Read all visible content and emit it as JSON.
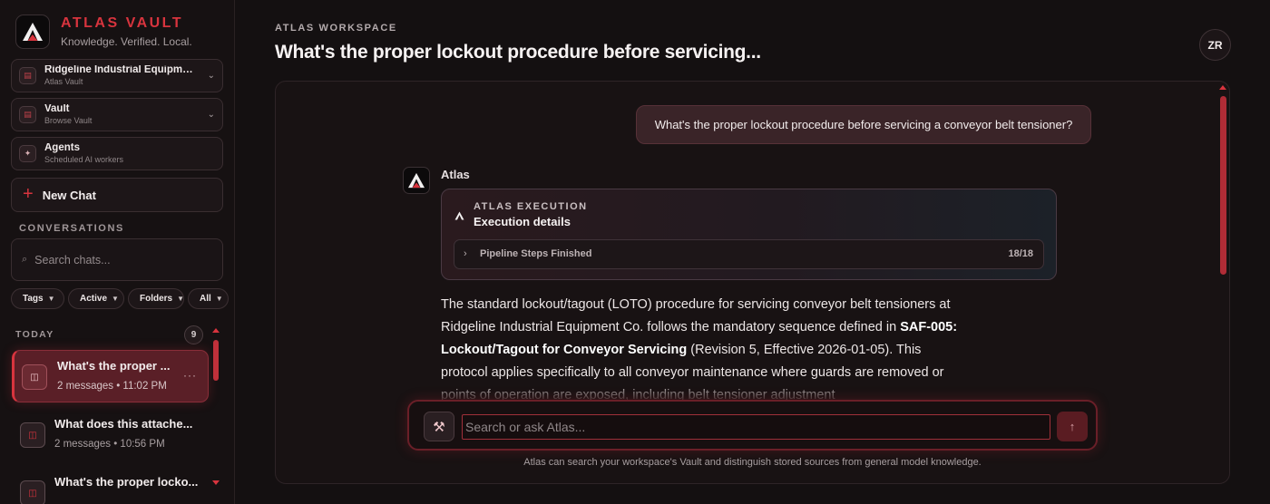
{
  "brand": {
    "title": "ATLAS VAULT",
    "subtitle": "Knowledge. Verified. Local."
  },
  "sidebar": {
    "workspace": {
      "title": "Ridgeline Industrial Equipme...",
      "subtitle": "Atlas Vault"
    },
    "vault": {
      "title": "Vault",
      "subtitle": "Browse Vault"
    },
    "agents": {
      "title": "Agents",
      "subtitle": "Scheduled AI workers"
    },
    "new_chat_label": "New Chat",
    "conversations_label": "CONVERSATIONS",
    "search_placeholder": "Search chats...",
    "filters": [
      "Tags",
      "Active",
      "Folders",
      "All"
    ],
    "today_label": "TODAY",
    "today_count": "9",
    "conversations": [
      {
        "title": "What's the proper ...",
        "meta": "2 messages • 11:02 PM"
      },
      {
        "title": "What does this attache...",
        "meta": "2 messages • 10:56 PM"
      },
      {
        "title": "What's the proper locko..."
      }
    ]
  },
  "header": {
    "workspace_label": "ATLAS WORKSPACE",
    "title": "What's the proper lockout procedure before servicing...",
    "avatar_initials": "ZR"
  },
  "chat": {
    "user_message": "What's the proper lockout procedure before servicing a conveyor belt tensioner?",
    "assistant_name": "Atlas",
    "execution": {
      "kicker": "ATLAS EXECUTION",
      "title": "Execution details",
      "step_label": "Pipeline Steps Finished",
      "step_count": "18/18"
    },
    "answer": {
      "part1": "The standard lockout/tagout (LOTO) procedure for servicing conveyor belt tensioners at Ridgeline Industrial Equipment Co. follows the mandatory sequence defined in ",
      "bold": "SAF-005: Lockout/Tagout for Conveyor Servicing",
      "part2": " (Revision 5, Effective 2026-01-05). This protocol applies specifically to all conveyor maintenance where guards are removed or points of operation are exposed, including belt tensioner adjustment"
    }
  },
  "composer": {
    "placeholder": "Search or ask Atlas...",
    "tool_icon": "hammer-pick-icon",
    "send_icon": "arrow-up-icon",
    "disclaimer": "Atlas can search your workspace's Vault and distinguish stored sources from general model knowledge."
  },
  "colors": {
    "accent": "#d8343e",
    "background": "#141011",
    "panel": "#181213"
  }
}
